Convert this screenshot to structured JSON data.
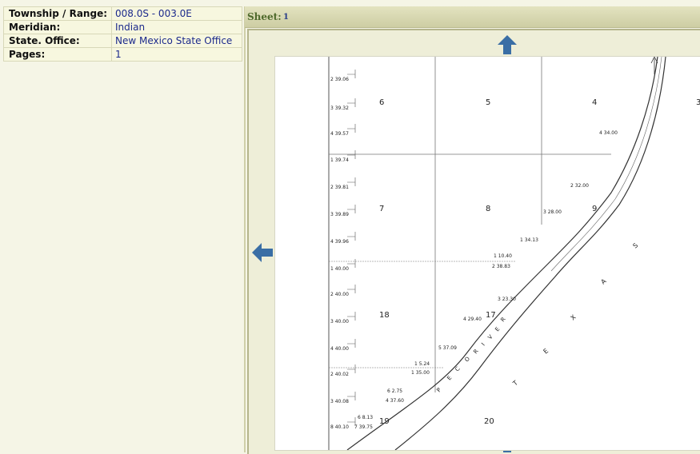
{
  "info": {
    "rows": [
      {
        "label": "Township / Range:",
        "value": "008.0S - 003.0E"
      },
      {
        "label": "Meridian:",
        "value": "Indian"
      },
      {
        "label": "State. Office:",
        "value": "New Mexico State Office"
      },
      {
        "label": "Pages:",
        "value": "1"
      }
    ]
  },
  "sheet": {
    "label": "Sheet:",
    "number": "1"
  },
  "map": {
    "sections": [
      "6",
      "5",
      "4",
      "3",
      "7",
      "8",
      "9",
      "18",
      "17",
      "19",
      "20"
    ],
    "left_margin_labels": [
      "2 39.06",
      "3 39.32",
      "4 39.57",
      "1 39.74",
      "2 39.81",
      "3 39.89",
      "4 39.96",
      "1 40.00",
      "2 40.00",
      "3 40.00",
      "4 40.00",
      "2 40.02",
      "3 40.08",
      "8 40.10"
    ],
    "lot_labels": [
      "4 34.00",
      "2 32.00",
      "3 28.00",
      "1 34.13",
      "1 10.40",
      "2 38.83",
      "3 23.30",
      "4 29.40",
      "5 37.09",
      "1 5.24",
      "1 35.00",
      "6 2.75",
      "4 37.60",
      "6 8.13",
      "7 39.75"
    ],
    "river_letters": [
      "P",
      "E",
      "C",
      "O",
      "R",
      "I",
      "V",
      "E",
      "R"
    ],
    "territory_letters": [
      "T",
      "E",
      "X",
      "A",
      "S"
    ]
  },
  "colors": {
    "accent": "#3a6ea5",
    "header_text": "#4f6a2c",
    "link": "#1c2a8c"
  },
  "icons": {
    "up": "arrow-up-icon",
    "left": "arrow-left-icon",
    "down": "arrow-down-icon"
  }
}
